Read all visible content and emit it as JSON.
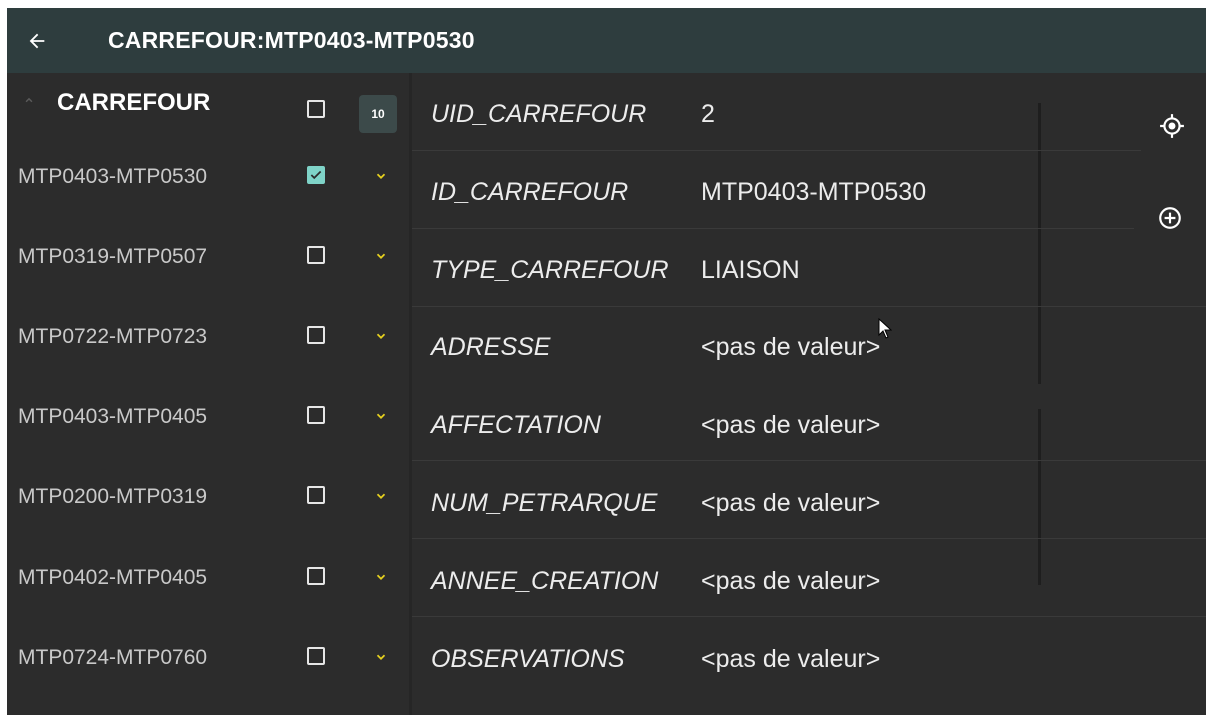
{
  "header": {
    "title": "CARREFOUR:MTP0403-MTP0530",
    "back_icon": "arrow-left-icon"
  },
  "sidebar": {
    "title": "CARREFOUR",
    "count": "10",
    "items": [
      {
        "label": "MTP0403-MTP0530",
        "checked": true
      },
      {
        "label": "MTP0319-MTP0507",
        "checked": false
      },
      {
        "label": "MTP0722-MTP0723",
        "checked": false
      },
      {
        "label": "MTP0403-MTP0405",
        "checked": false
      },
      {
        "label": "MTP0200-MTP0319",
        "checked": false
      },
      {
        "label": "MTP0402-MTP0405",
        "checked": false
      },
      {
        "label": "MTP0724-MTP0760",
        "checked": false
      }
    ]
  },
  "attributes": [
    {
      "key": "UID_CARREFOUR",
      "value": "2"
    },
    {
      "key": "ID_CARREFOUR",
      "value": "MTP0403-MTP0530"
    },
    {
      "key": "TYPE_CARREFOUR",
      "value": "LIAISON"
    },
    {
      "key": "ADRESSE",
      "value": "<pas de valeur>"
    },
    {
      "key": "AFFECTATION",
      "value": "<pas de valeur>"
    },
    {
      "key": "NUM_PETRARQUE",
      "value": "<pas de valeur>"
    },
    {
      "key": "ANNEE_CREATION",
      "value": "<pas de valeur>"
    },
    {
      "key": "OBSERVATIONS",
      "value": "<pas de valeur>"
    }
  ],
  "actions": {
    "locate_icon": "crosshair-locate-icon",
    "zoom_icon": "zoom-in-icon"
  },
  "colors": {
    "topbar": "#2e3d3e",
    "background": "#2c2c2c",
    "checkbox_checked": "#7fd3c8",
    "chevron": "#e8d21e"
  }
}
